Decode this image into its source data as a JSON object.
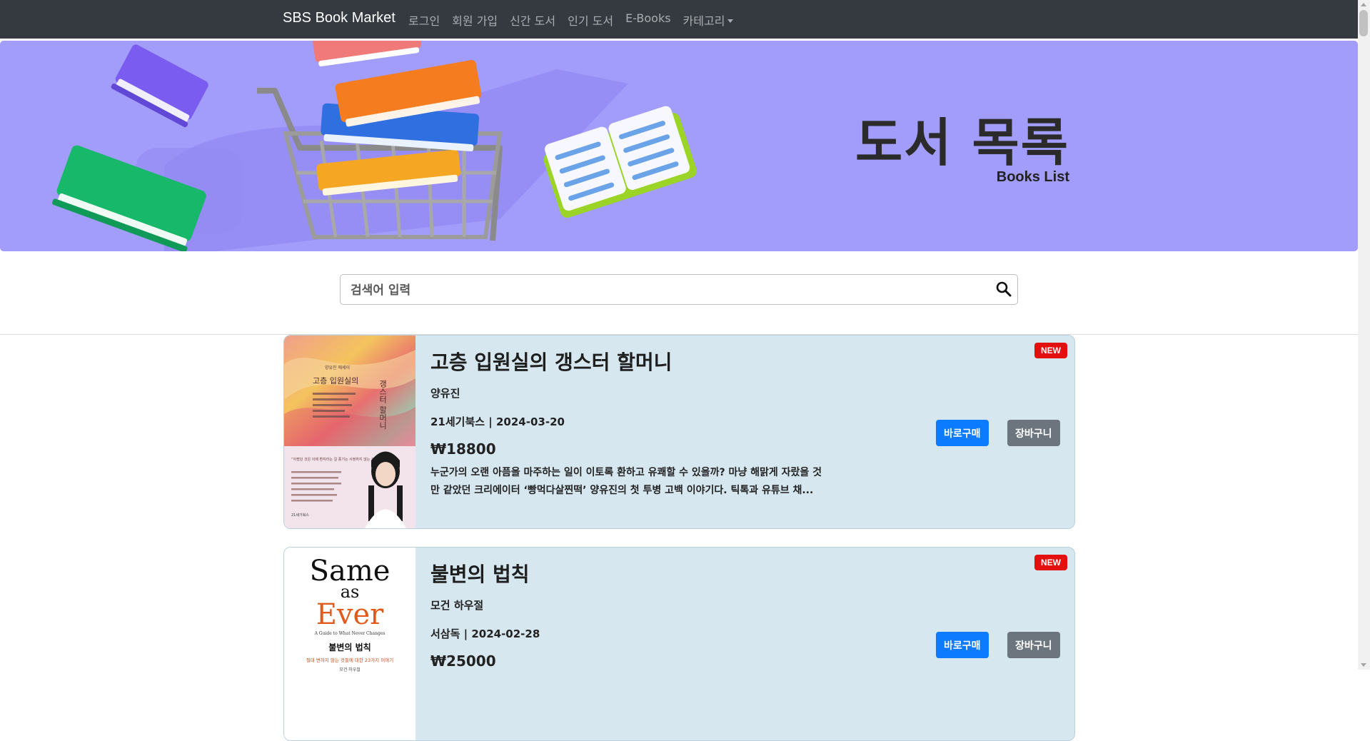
{
  "navbar": {
    "brand": "SBS Book Market",
    "links": [
      "로그인",
      "회원 가입",
      "신간 도서",
      "인기 도서",
      "E-Books",
      "카테고리"
    ]
  },
  "banner": {
    "title": "도서 목록",
    "subtitle": "Books List"
  },
  "search": {
    "placeholder": "검색어 입력",
    "icon": "search-icon"
  },
  "books": [
    {
      "title": "고층 입원실의 갱스터 할머니",
      "author": "양유진",
      "publisher_date": "21세기북스 | 2024-03-20",
      "price": "₩18800",
      "description": "누군가의 오랜 아픔을 마주하는 일이 이토록 환하고 유쾌할 수 있을까? 마냥 해맑게 자랐을 것만 같았던 크리에이터 ‘빵먹다살찐떡’ 양유진의 첫 투병 고백 이야기다. 틱톡과 유튜브 채...",
      "badge": "NEW",
      "buy_label": "바로구매",
      "cart_label": "장바구니",
      "cover": {
        "series": "양유진 에세이",
        "title_left": "고층 입원실의",
        "title_right": "갱스터 할머니",
        "quote": "“아팠던 것은 이제 환자라는 걸 풍기는 사정하지 않는 것이다”",
        "publisher": "21세기북스"
      }
    },
    {
      "title": "불변의 법칙",
      "author": "모건 하우절",
      "publisher_date": "서삼독 | 2024-02-28",
      "price": "₩25000",
      "badge": "NEW",
      "buy_label": "바로구매",
      "cart_label": "장바구니",
      "cover": {
        "line1": "Same",
        "line2": "as",
        "line3": "Ever",
        "tagline": "A Guide to What Never Changes",
        "kr_title": "불변의 법칙",
        "kr_sub": "절대 변하지 않는 것들에 대한 23가지 이야기",
        "author_kr": "모건 하우절"
      }
    }
  ],
  "colors": {
    "navbar": "#343a40",
    "banner": "#a29cfa",
    "card": "#d6e7f0",
    "primary": "#0d7bff",
    "secondary": "#6c757d",
    "badge": "#e4100f"
  }
}
